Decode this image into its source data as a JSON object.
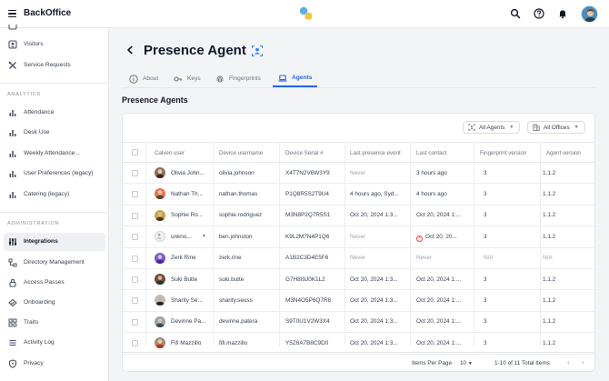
{
  "app": {
    "title": "BackOffice"
  },
  "colors": {
    "accent": "#2563eb",
    "error": "#ef4444"
  },
  "sidebar": {
    "items_top": [
      {
        "label": "Visitors",
        "icon": "visitors-icon"
      },
      {
        "label": "Service Requests",
        "icon": "tools-icon"
      }
    ],
    "analytics_title": "ANALYTICS",
    "analytics": [
      {
        "label": "Attendance",
        "icon": "bar-chart-icon"
      },
      {
        "label": "Desk Use",
        "icon": "bar-chart-icon"
      },
      {
        "label": "Weekly Attendance...",
        "icon": "bar-chart-icon"
      },
      {
        "label": "User Preferences (legacy)",
        "icon": "bar-chart-icon"
      },
      {
        "label": "Catering (legacy)",
        "icon": "bar-chart-icon"
      }
    ],
    "admin_title": "ADMINISTRATION",
    "admin": [
      {
        "label": "Integrations",
        "icon": "integrations-icon"
      },
      {
        "label": "Directory Management",
        "icon": "directory-icon"
      },
      {
        "label": "Access Passes",
        "icon": "lock-icon"
      },
      {
        "label": "Onboarding",
        "icon": "onboarding-icon"
      },
      {
        "label": "Traits",
        "icon": "traits-icon"
      },
      {
        "label": "Activity Log",
        "icon": "list-icon"
      },
      {
        "label": "Privacy",
        "icon": "shield-icon"
      }
    ]
  },
  "page": {
    "title": "Presence Agent",
    "section_title": "Presence Agents"
  },
  "tabs": [
    {
      "label": "About",
      "icon": "info-icon"
    },
    {
      "label": "Keys",
      "icon": "key-icon"
    },
    {
      "label": "Fingerprints",
      "icon": "fingerprint-icon"
    },
    {
      "label": "Agents",
      "icon": "laptop-icon"
    }
  ],
  "filters": {
    "agents": "All Agents",
    "offices": "All Offices"
  },
  "table": {
    "columns": [
      "Calven user",
      "Device username",
      "Device Serial #",
      "Last presence event",
      "Last contact",
      "Fingerprint version",
      "Agent version"
    ],
    "rows": [
      {
        "user": "Olivia John...",
        "username": "olivia.johnson",
        "serial": "X4T7N2V6W3Y9",
        "presence": "Never",
        "contact": "3 hours ago",
        "fingerprint": "3",
        "agent": "1.1.2"
      },
      {
        "user": "Nathan Th...",
        "username": "nathan.thomas",
        "serial": "P1Q8R5S2T9U4",
        "presence": "4 hours ago, Syd...",
        "contact": "4 hours ago",
        "fingerprint": "3",
        "agent": "1.1.2"
      },
      {
        "user": "Sophie Ro...",
        "username": "sophie.rodriguez",
        "serial": "M3N8P2Q7R5S1",
        "presence": "Oct 20, 2024 1:3...",
        "contact": "Oct 20, 2024 1:...",
        "fingerprint": "3",
        "agent": "1.1.2"
      },
      {
        "user": "unkno...",
        "username": "ben.johnston",
        "serial": "K9L2M7N4P1Q6",
        "presence": "Never",
        "contact": "Oct 20, 20...",
        "fingerprint": "3",
        "agent": "1.1.2"
      },
      {
        "user": "Zerk Rine",
        "username": "zerk.rine",
        "serial": "A1B2C3D4E5F6",
        "presence": "Never",
        "contact": "Never",
        "fingerprint": "N/A",
        "agent": "N/A"
      },
      {
        "user": "Suki Butte",
        "username": "suki.butte",
        "serial": "G7H8I9J0K1L2",
        "presence": "Oct 20, 2024 1:3...",
        "contact": "Oct 20, 2024 1:...",
        "fingerprint": "3",
        "agent": "1.1.2"
      },
      {
        "user": "Sharity Se...",
        "username": "sharity.seuss",
        "serial": "M3N4O5P6Q7R8",
        "presence": "Oct 20, 2024 1:3...",
        "contact": "Oct 20, 2024 1:...",
        "fingerprint": "3",
        "agent": "1.1.2"
      },
      {
        "user": "Devinne Pa...",
        "username": "devinne.patera",
        "serial": "S9T0U1V2W3X4",
        "presence": "Oct 20, 2024 1:3...",
        "contact": "Oct 20, 2024 1:...",
        "fingerprint": "3",
        "agent": "1.1.2"
      },
      {
        "user": "Fifi Mazzillo",
        "username": "fifi.mazzillo",
        "serial": "Y5Z6A7B8C9D0",
        "presence": "Oct 20, 2024 1:3...",
        "contact": "Oct 20, 2024 1:...",
        "fingerprint": "3",
        "agent": "1.1.2"
      }
    ]
  },
  "pagination": {
    "items_per_page_label": "Items Per Page",
    "items_per_page": "10",
    "range": "1-10 of 11 Total Items"
  }
}
